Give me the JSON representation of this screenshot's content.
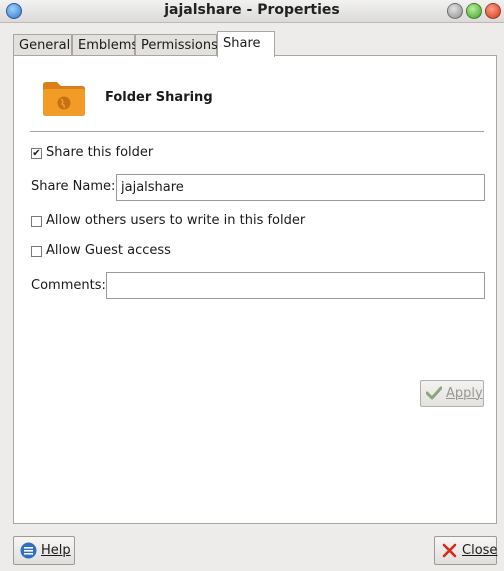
{
  "window": {
    "title": "jajalshare - Properties"
  },
  "tabs": [
    {
      "label": "General"
    },
    {
      "label": "Emblems"
    },
    {
      "label": "Permissions"
    },
    {
      "label": "Share",
      "active": true
    }
  ],
  "share": {
    "heading": "Folder Sharing",
    "share_this_folder": {
      "label": "Share this folder",
      "checked": true
    },
    "share_name": {
      "label": "Share Name:",
      "value": "jajalshare"
    },
    "allow_write": {
      "label": "Allow others users to write in this folder",
      "checked": false
    },
    "allow_guest": {
      "label": "Allow Guest access",
      "checked": false
    },
    "comments": {
      "label": "Comments:",
      "value": ""
    },
    "apply": {
      "label": "Apply",
      "enabled": false
    }
  },
  "buttons": {
    "help": {
      "label": "Help"
    },
    "close": {
      "label": "Close"
    }
  },
  "colors": {
    "folder": "#f29b27",
    "folder_dark": "#d9801a",
    "help_icon": "#2f6fc4",
    "close_icon": "#d42a1a",
    "apply_check": "#8aa67a"
  }
}
